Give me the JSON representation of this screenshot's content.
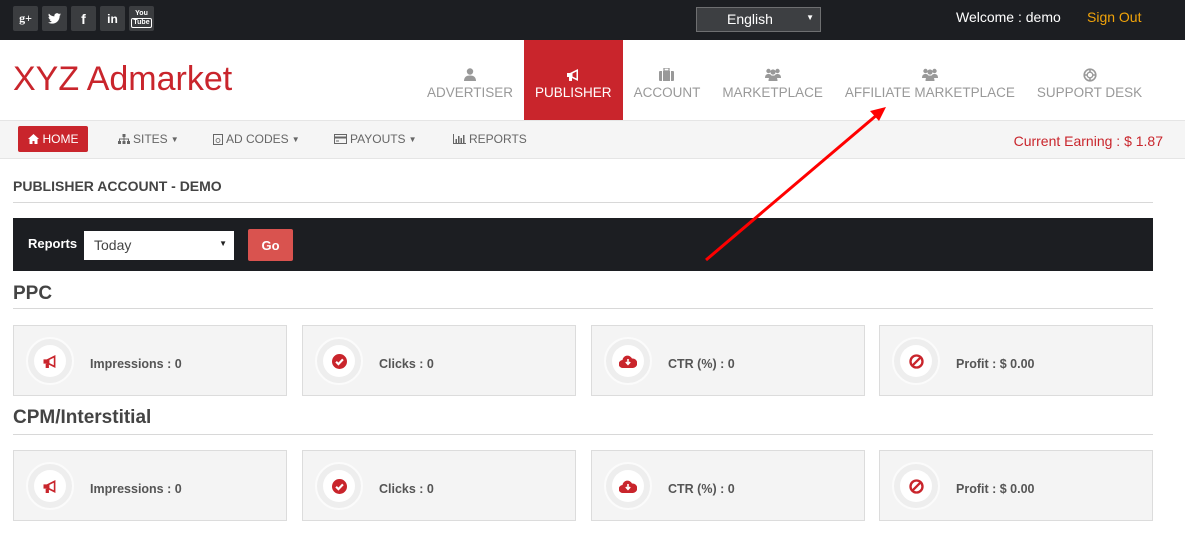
{
  "topbar": {
    "social": [
      {
        "icon": "google-plus-icon",
        "glyph": "g+"
      },
      {
        "icon": "twitter-icon",
        "glyph": "t"
      },
      {
        "icon": "facebook-icon",
        "glyph": "f"
      },
      {
        "icon": "linkedin-icon",
        "glyph": "in"
      },
      {
        "icon": "youtube-icon",
        "glyph_top": "You",
        "glyph_bottom": "Tube"
      }
    ],
    "language": "English",
    "welcome": "Welcome : demo",
    "sign_out": "Sign Out"
  },
  "header": {
    "logo": "XYZ Admarket",
    "nav": [
      {
        "label": "ADVERTISER",
        "icon": "user-icon",
        "active": false
      },
      {
        "label": "PUBLISHER",
        "icon": "bullhorn-icon",
        "active": true
      },
      {
        "label": "ACCOUNT",
        "icon": "briefcase-icon",
        "active": false
      },
      {
        "label": "MARKETPLACE",
        "icon": "users-icon",
        "active": false
      },
      {
        "label": "AFFILIATE MARKETPLACE",
        "icon": "users-icon",
        "active": false
      },
      {
        "label": "SUPPORT DESK",
        "icon": "life-ring-icon",
        "active": false
      }
    ]
  },
  "subnav": {
    "home": "HOME",
    "items": [
      {
        "label": "SITES",
        "icon": "sitemap-icon",
        "dropdown": true
      },
      {
        "label": "AD CODES",
        "icon": "code-file-icon",
        "dropdown": true
      },
      {
        "label": "PAYOUTS",
        "icon": "credit-card-icon",
        "dropdown": true
      },
      {
        "label": "REPORTS",
        "icon": "bar-chart-icon",
        "dropdown": false
      }
    ],
    "current_earning": "Current Earning : $ 1.87"
  },
  "content": {
    "page_title": "PUBLISHER ACCOUNT - DEMO",
    "reports": {
      "label": "Reports",
      "selected": "Today",
      "go": "Go"
    },
    "sections": [
      {
        "title": "PPC",
        "cards": [
          {
            "icon": "bullhorn-icon",
            "text": "Impressions : 0"
          },
          {
            "icon": "check-circle-icon",
            "text": "Clicks : 0"
          },
          {
            "icon": "cloud-download-icon",
            "text": "CTR (%) : 0"
          },
          {
            "icon": "ban-icon",
            "text": "Profit : $ 0.00"
          }
        ]
      },
      {
        "title": "CPM/Interstitial",
        "cards": [
          {
            "icon": "bullhorn-icon",
            "text": "Impressions : 0"
          },
          {
            "icon": "check-circle-icon",
            "text": "Clicks : 0"
          },
          {
            "icon": "cloud-download-icon",
            "text": "CTR (%) : 0"
          },
          {
            "icon": "ban-icon",
            "text": "Profit : $ 0.00"
          }
        ]
      }
    ]
  },
  "colors": {
    "brand_red": "#c9252c",
    "go_button": "#d9534f",
    "sign_out": "#f0a30a",
    "dark_bar": "#1c1e22",
    "annotation_arrow": "#ff0000"
  }
}
